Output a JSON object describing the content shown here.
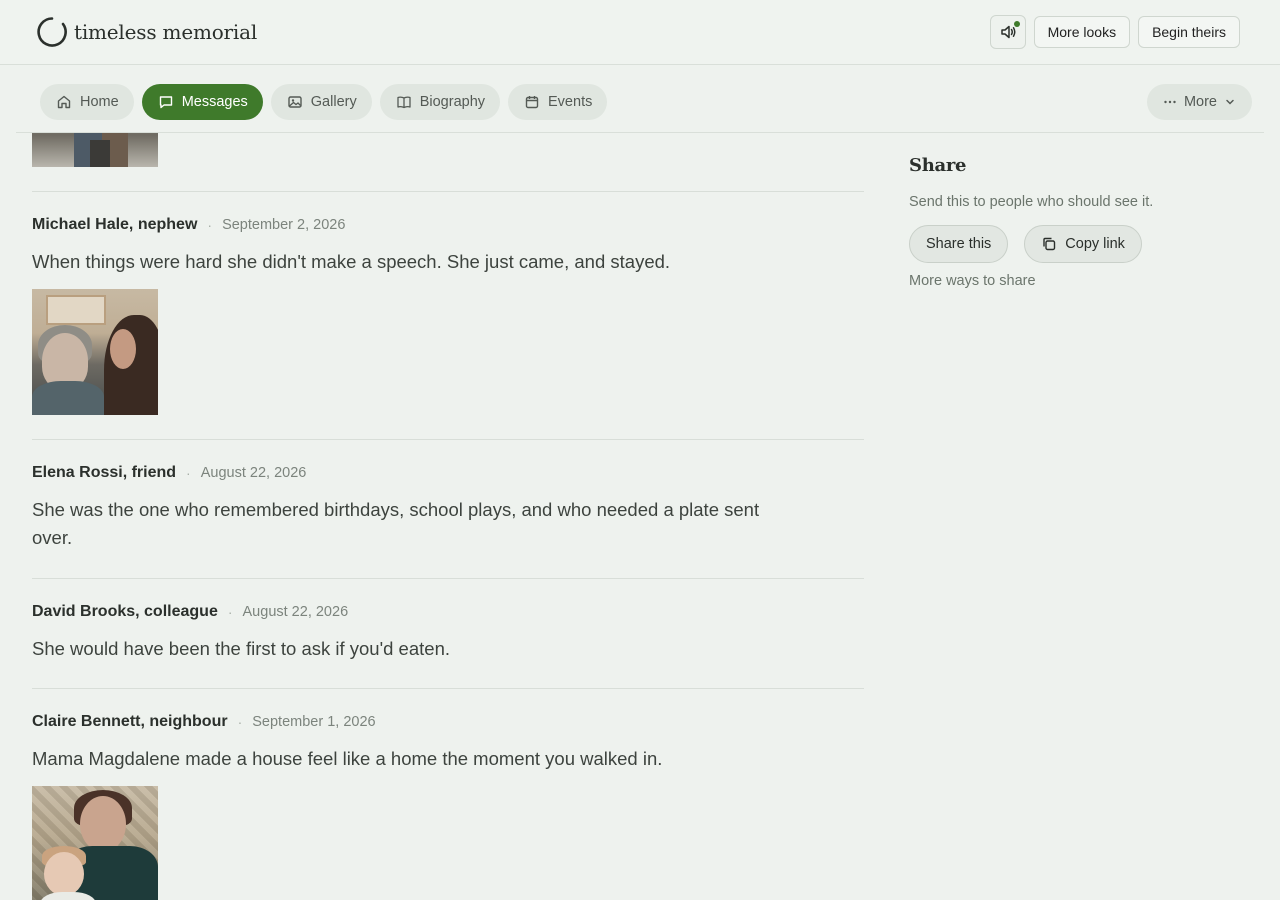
{
  "header": {
    "brand_name": "timeless memorial",
    "more_looks_label": "More looks",
    "begin_theirs_label": "Begin theirs"
  },
  "nav": {
    "tabs": [
      {
        "label": "Home",
        "icon": "home-icon",
        "active": false
      },
      {
        "label": "Messages",
        "icon": "message-icon",
        "active": true
      },
      {
        "label": "Gallery",
        "icon": "gallery-icon",
        "active": false
      },
      {
        "label": "Biography",
        "icon": "book-icon",
        "active": false
      },
      {
        "label": "Events",
        "icon": "calendar-icon",
        "active": false
      }
    ],
    "more_label": "More"
  },
  "messages": [
    {
      "author": "Michael Hale, nephew",
      "date": "September 2, 2026",
      "text": "When things were hard she didn't make a speech. She just came, and stayed.",
      "has_photo": true
    },
    {
      "author": "Elena Rossi, friend",
      "date": "August 22, 2026",
      "text": "She was the one who remembered birthdays, school plays, and who needed a plate sent over.",
      "has_photo": false
    },
    {
      "author": "David Brooks, colleague",
      "date": "August 22, 2026",
      "text": "She would have been the first to ask if you'd eaten.",
      "has_photo": false
    },
    {
      "author": "Claire Bennett, neighbour",
      "date": "September 1, 2026",
      "text": "Mama Magdalene made a house feel like a home the moment you walked in.",
      "has_photo": true
    }
  ],
  "share": {
    "title": "Share",
    "subtitle": "Send this to people who should see it.",
    "share_this_label": "Share this",
    "copy_link_label": "Copy link",
    "more_ways_label": "More ways to share"
  },
  "colors": {
    "accent": "#3f7a2b",
    "background": "#eef2ee",
    "notification_dot": "#3e7a2a"
  }
}
